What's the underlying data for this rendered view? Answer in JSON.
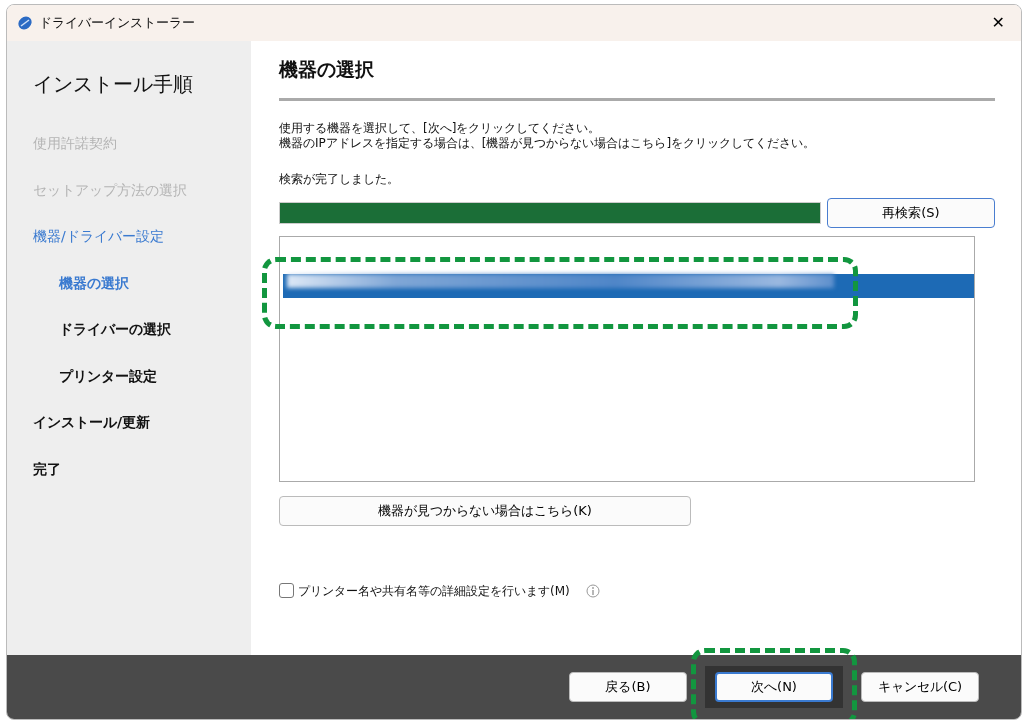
{
  "window": {
    "title": "ドライバーインストーラー",
    "close_glyph": "✕"
  },
  "sidebar": {
    "title": "インストール手順",
    "steps": [
      {
        "label": "使用許諾契約",
        "completed": true,
        "in_progress": false,
        "selected": false
      },
      {
        "label": "セットアップ方法の選択",
        "completed": true,
        "in_progress": false,
        "selected": false
      },
      {
        "label": "機器/ドライバー設定",
        "completed": false,
        "in_progress": true,
        "selected": false,
        "children": [
          {
            "label": "機器の選択",
            "completed": false,
            "in_progress": false,
            "selected": true
          },
          {
            "label": "ドライバーの選択",
            "completed": false,
            "in_progress": false,
            "selected": false
          },
          {
            "label": "プリンター設定",
            "completed": false,
            "in_progress": false,
            "selected": false
          }
        ]
      },
      {
        "label": "インストール/更新",
        "completed": false,
        "in_progress": false,
        "selected": false
      },
      {
        "label": "完了",
        "completed": false,
        "in_progress": false,
        "selected": false
      }
    ]
  },
  "page": {
    "title": "機器の選択",
    "instructions": [
      "使用する機器を選択して、[次へ]をクリックしてください。",
      "機器のIPアドレスを指定する場合は、[機器が見つからない場合はこちら]をクリックしてください。"
    ],
    "search_status": "検索が完了しました。",
    "search_progress": {
      "level": 1
    },
    "research_button": "再検索(S)",
    "device_list": {
      "rows": [
        {
          "selected": true,
          "highlighted": true
        }
      ]
    },
    "not_found_button": "機器が見つからない場合はこちら(K)",
    "advanced_checkbox": {
      "label": "プリンター名や共有名等の詳細設定を行います(M)",
      "checked": false
    }
  },
  "footer": {
    "buttons": [
      {
        "label": "戻る(B)",
        "focused": false,
        "highlighted": false
      },
      {
        "label": "次へ(N)",
        "focused": true,
        "highlighted": true
      },
      {
        "label": "キャンセル(C)",
        "focused": false,
        "highlighted": false
      }
    ]
  }
}
